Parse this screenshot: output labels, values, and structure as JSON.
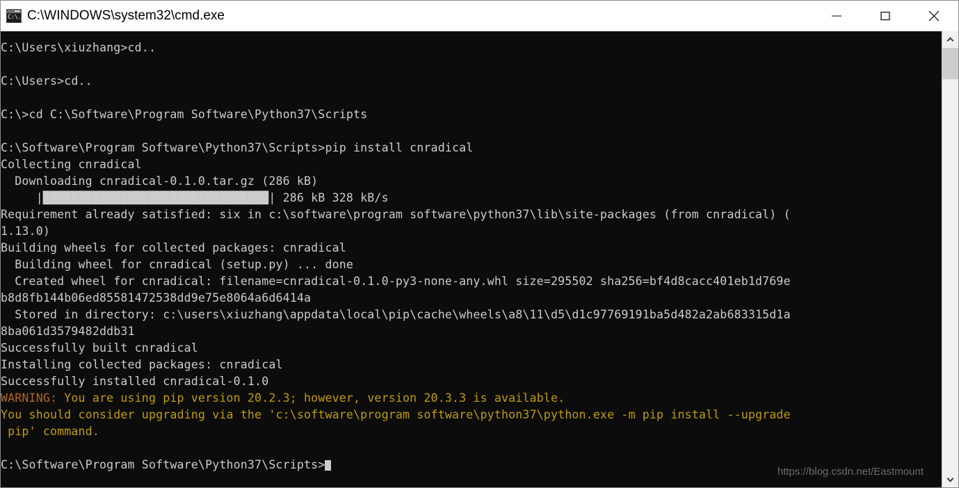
{
  "window": {
    "title": "C:\\WINDOWS\\system32\\cmd.exe",
    "icon": "cmd-console-icon",
    "icon_glyph": "C:\\.",
    "controls": {
      "minimize_label": "Minimize",
      "maximize_label": "Maximize",
      "close_label": "Close"
    }
  },
  "colors": {
    "console_bg": "#0c0c0c",
    "console_fg": "#cccccc",
    "warning_fg": "#c19c00",
    "warning_head_fg": "#b5651d",
    "titlebar_bg": "#ffffff",
    "titlebar_fg": "#000000",
    "scrollbar_track": "#f0f0f0",
    "scrollbar_thumb": "#cdcdcd"
  },
  "console": {
    "lines": [
      {
        "text": "C:\\Users\\xiuzhang>cd..",
        "style": "normal"
      },
      {
        "text": "",
        "style": "normal"
      },
      {
        "text": "C:\\Users>cd..",
        "style": "normal"
      },
      {
        "text": "",
        "style": "normal"
      },
      {
        "text": "C:\\>cd C:\\Software\\Program Software\\Python37\\Scripts",
        "style": "normal"
      },
      {
        "text": "",
        "style": "normal"
      },
      {
        "text": "C:\\Software\\Program Software\\Python37\\Scripts>pip install cnradical",
        "style": "normal"
      },
      {
        "text": "Collecting cnradical",
        "style": "normal"
      },
      {
        "text": "  Downloading cnradical-0.1.0.tar.gz (286 kB)",
        "style": "normal"
      },
      {
        "text": "     |████████████████████████████████| 286 kB 328 kB/s",
        "style": "progress"
      },
      {
        "text": "Requirement already satisfied: six in c:\\software\\program software\\python37\\lib\\site-packages (from cnradical) (",
        "style": "normal"
      },
      {
        "text": "1.13.0)",
        "style": "normal"
      },
      {
        "text": "Building wheels for collected packages: cnradical",
        "style": "normal"
      },
      {
        "text": "  Building wheel for cnradical (setup.py) ... done",
        "style": "normal"
      },
      {
        "text": "  Created wheel for cnradical: filename=cnradical-0.1.0-py3-none-any.whl size=295502 sha256=bf4d8cacc401eb1d769e",
        "style": "normal"
      },
      {
        "text": "b8d8fb144b06ed85581472538dd9e75e8064a6d6414a",
        "style": "normal"
      },
      {
        "text": "  Stored in directory: c:\\users\\xiuzhang\\appdata\\local\\pip\\cache\\wheels\\a8\\11\\d5\\d1c97769191ba5d482a2ab683315d1a",
        "style": "normal"
      },
      {
        "text": "8ba061d3579482ddb31",
        "style": "normal"
      },
      {
        "text": "Successfully built cnradical",
        "style": "normal"
      },
      {
        "text": "Installing collected packages: cnradical",
        "style": "normal"
      },
      {
        "text": "Successfully installed cnradical-0.1.0",
        "style": "normal"
      },
      {
        "text": "WARNING: You are using pip version 20.2.3; however, version 20.3.3 is available.",
        "style": "warning-head"
      },
      {
        "text": "You should consider upgrading via the 'c:\\software\\program software\\python37\\python.exe -m pip install --upgrade",
        "style": "warning"
      },
      {
        "text": " pip' command.",
        "style": "warning"
      },
      {
        "text": "",
        "style": "normal"
      },
      {
        "text": "C:\\Software\\Program Software\\Python37\\Scripts>",
        "style": "prompt-cursor"
      }
    ],
    "warning_head_word": "WARNING:",
    "prompt_current": "C:\\Software\\Program Software\\Python37\\Scripts>",
    "progress": {
      "pct": 100,
      "blocks": 32,
      "downloaded": "286 kB",
      "speed": "328 kB/s",
      "file": "cnradical-0.1.0.tar.gz",
      "size": "286 kB"
    }
  },
  "watermark": {
    "text": "https://blog.csdn.net/Eastmount"
  },
  "scrollbar": {
    "up_arrow": "chevron-up-icon",
    "down_arrow": "chevron-down-icon",
    "thumb_position_pct": 0
  }
}
